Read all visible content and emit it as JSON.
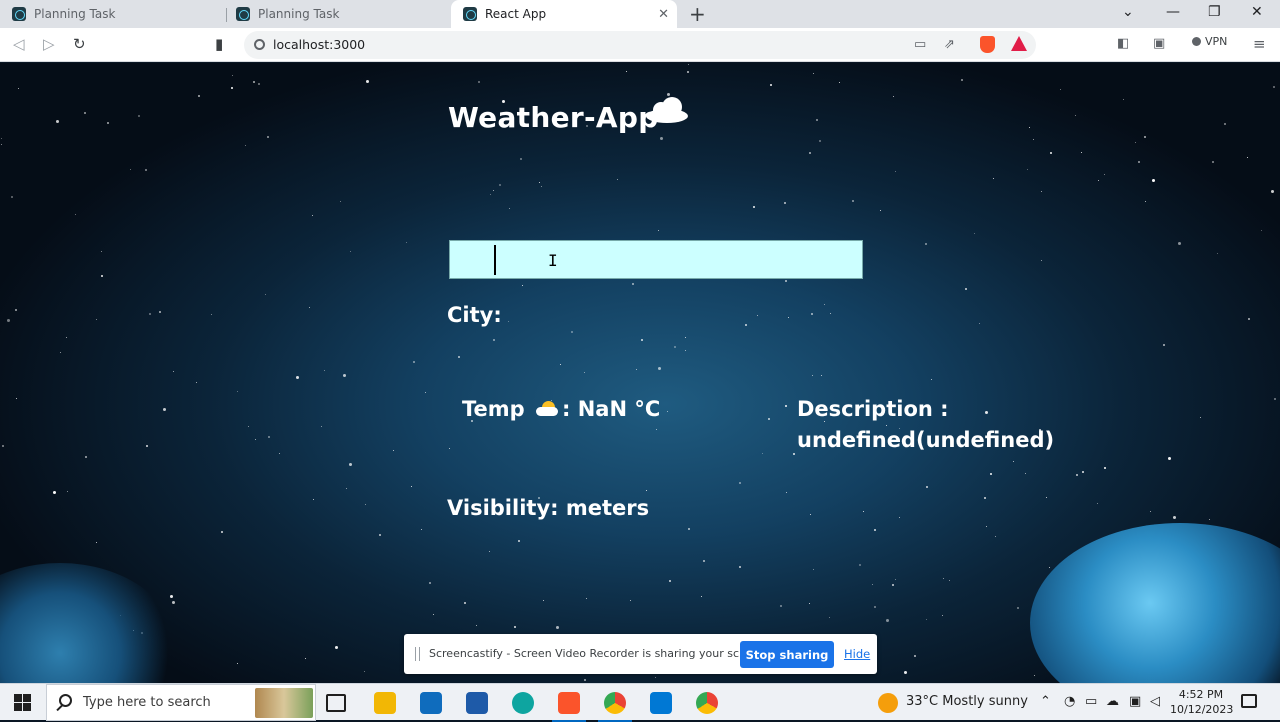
{
  "browser": {
    "tabs": [
      {
        "label": "Planning Task",
        "active": false
      },
      {
        "label": "Planning Task",
        "active": false
      },
      {
        "label": "React App",
        "active": true
      }
    ],
    "url": "localhost:3000",
    "vpn_label": "VPN",
    "tab_close_glyph": "✕",
    "new_tab_glyph": "+",
    "window_controls": {
      "chevron": "⌄",
      "minimize": "—",
      "restore": "❐",
      "close": "✕"
    }
  },
  "app": {
    "title": "Weather-App",
    "search": {
      "value": "",
      "placeholder": ""
    },
    "city_label": "City:",
    "temp_prefix": "Temp",
    "temp_value": ": NaN °C",
    "description_label": "Description :",
    "description_value": "undefined(undefined)",
    "visibility_text": "Visibility: meters"
  },
  "screencastify": {
    "message": "Screencastify - Screen Video Recorder is sharing your screen.",
    "stop_label": "Stop sharing",
    "hide_label": "Hide"
  },
  "taskbar": {
    "search_placeholder": "Type here to search",
    "weather": "33°C  Mostly sunny",
    "time": "4:52 PM",
    "date": "10/12/2023"
  },
  "colors": {
    "input_bg": "#ccffff",
    "stop_button": "#1a73e8",
    "tabbar_bg": "#dee1e6"
  },
  "icons": [
    "react-favicon",
    "close-icon",
    "plus-icon",
    "back-icon",
    "forward-icon",
    "reload-icon",
    "bookmark-icon",
    "info-icon",
    "brave-shield-icon",
    "brave-rewards-icon",
    "sidebar-icon",
    "wallet-icon",
    "menu-icon",
    "cloud-icon",
    "sun-cloud-icon",
    "windows-logo-icon",
    "search-icon"
  ]
}
